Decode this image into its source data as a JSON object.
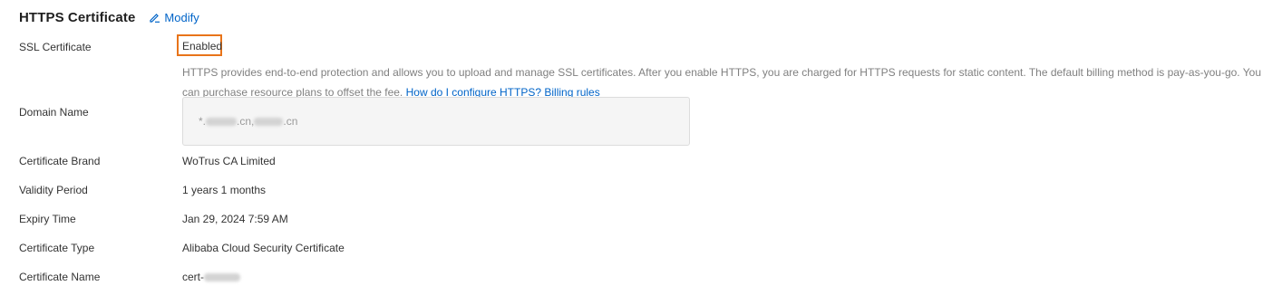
{
  "header": {
    "title": "HTTPS Certificate",
    "modify_label": "Modify"
  },
  "ssl": {
    "label": "SSL Certificate",
    "value": "Enabled"
  },
  "description": {
    "text": "HTTPS provides end-to-end protection and allows you to upload and manage SSL certificates. After you enable HTTPS, you are charged for HTTPS requests for static content. The default billing method is pay-as-you-go. You can purchase resource plans to offset the fee.",
    "link_configure": "How do I configure HTTPS?",
    "link_billing": "Billing rules"
  },
  "domain": {
    "label": "Domain Name",
    "prefix": "*.",
    "part1_suffix": ".cn,",
    "part2_suffix": ".cn"
  },
  "brand": {
    "label": "Certificate Brand",
    "value": "WoTrus CA Limited"
  },
  "validity": {
    "label": "Validity Period",
    "value": "1 years 1 months"
  },
  "expiry": {
    "label": "Expiry Time",
    "value": "Jan 29, 2024 7:59 AM"
  },
  "type": {
    "label": "Certificate Type",
    "value": "Alibaba Cloud Security Certificate"
  },
  "name": {
    "label": "Certificate Name",
    "prefix": "cert-"
  },
  "colors": {
    "accent": "#0064c8",
    "highlight": "#e8741a"
  }
}
